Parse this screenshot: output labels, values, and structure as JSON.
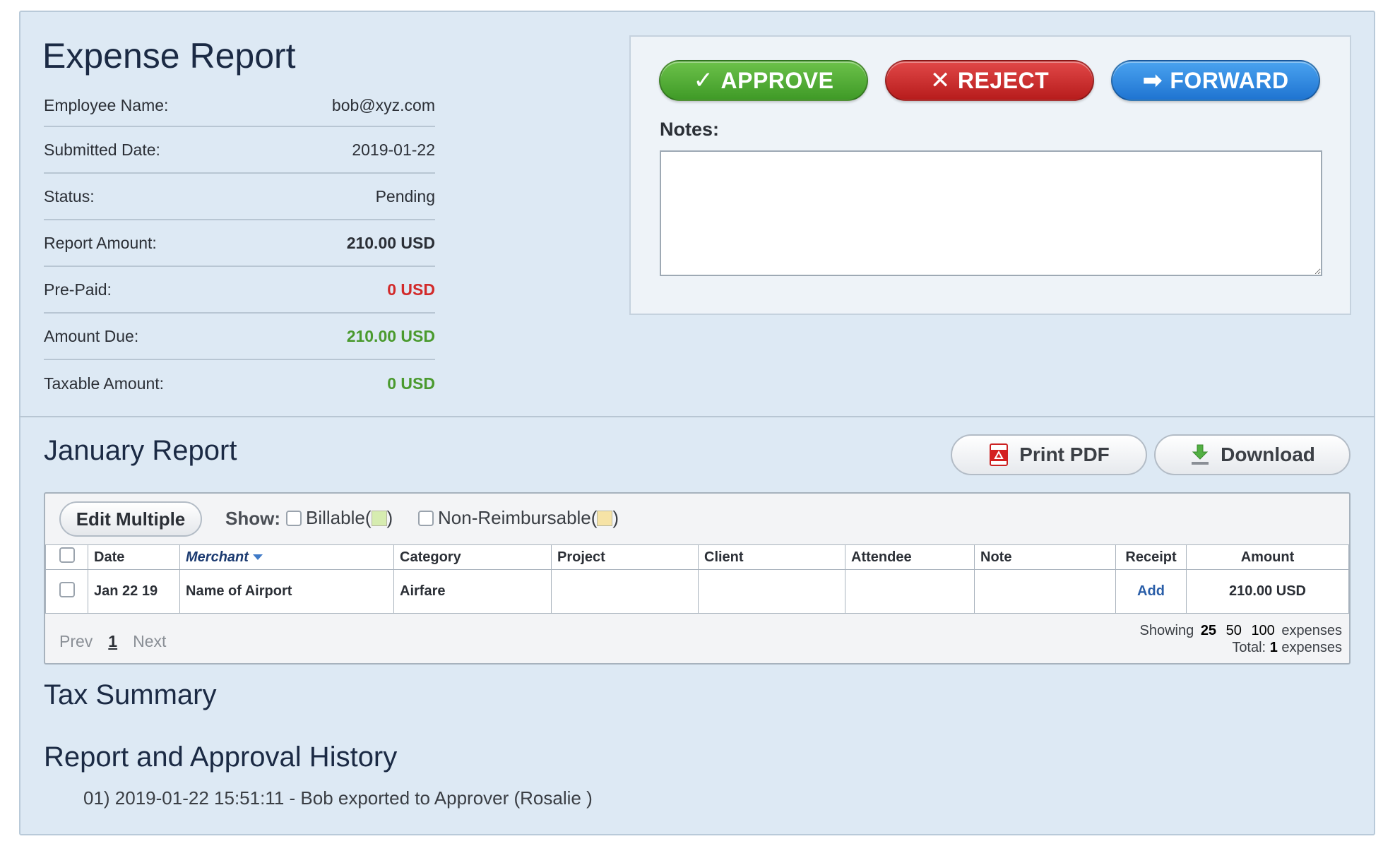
{
  "title": "Expense Report",
  "summary": [
    {
      "label": "Employee Name:",
      "value": "bob@xyz.com"
    },
    {
      "label": "Submitted Date:",
      "value": "2019-01-22"
    },
    {
      "label": "Status:",
      "value": "Pending"
    },
    {
      "label": "Report Amount:",
      "value": "210.00 USD"
    },
    {
      "label": "Pre-Paid:",
      "value": "0 USD"
    },
    {
      "label": "Amount Due:",
      "value": "210.00 USD"
    },
    {
      "label": "Taxable Amount:",
      "value": "0 USD"
    }
  ],
  "actions": {
    "approve": "APPROVE",
    "reject": "REJECT",
    "forward": "FORWARD",
    "notes_label": "Notes:",
    "notes_value": ""
  },
  "report": {
    "title": "January Report",
    "print_pdf": "Print PDF",
    "download": "Download",
    "edit_multiple": "Edit Multiple",
    "show_label": "Show:",
    "billable": "Billable(",
    "non_reimbursable": "Non-Reimbursable(",
    "close_paren": ")",
    "billable_color": "#d6ecb0",
    "non_reimbursable_color": "#f6e3a6",
    "columns": [
      "Date",
      "Merchant",
      "Category",
      "Project",
      "Client",
      "Attendee",
      "Note",
      "Receipt",
      "Amount"
    ],
    "rows": [
      {
        "date": "Jan 22 19",
        "merchant": "Name of Airport",
        "category": "Airfare",
        "project": "",
        "client": "",
        "attendee": "",
        "note": "",
        "receipt": "Add",
        "amount": "210.00 USD"
      }
    ],
    "pager": {
      "prev": "Prev",
      "page": "1",
      "next": "Next"
    },
    "showing": {
      "label": "Showing",
      "options": [
        "25",
        "50",
        "100"
      ],
      "suffix": "expenses",
      "total_label": "Total:",
      "total": "1",
      "total_suffix": "expenses"
    }
  },
  "tax_summary_title": "Tax Summary",
  "history": {
    "title": "Report and Approval History",
    "items": [
      "01) 2019-01-22 15:51:11 - Bob exported to Approver (Rosalie )"
    ]
  },
  "colors": {
    "panel_bg": "#dde9f4",
    "approve": "#4fae30",
    "reject": "#c92a2a",
    "forward": "#2b84e0",
    "negative": "#d22a2a",
    "positive": "#4a9a2e"
  }
}
